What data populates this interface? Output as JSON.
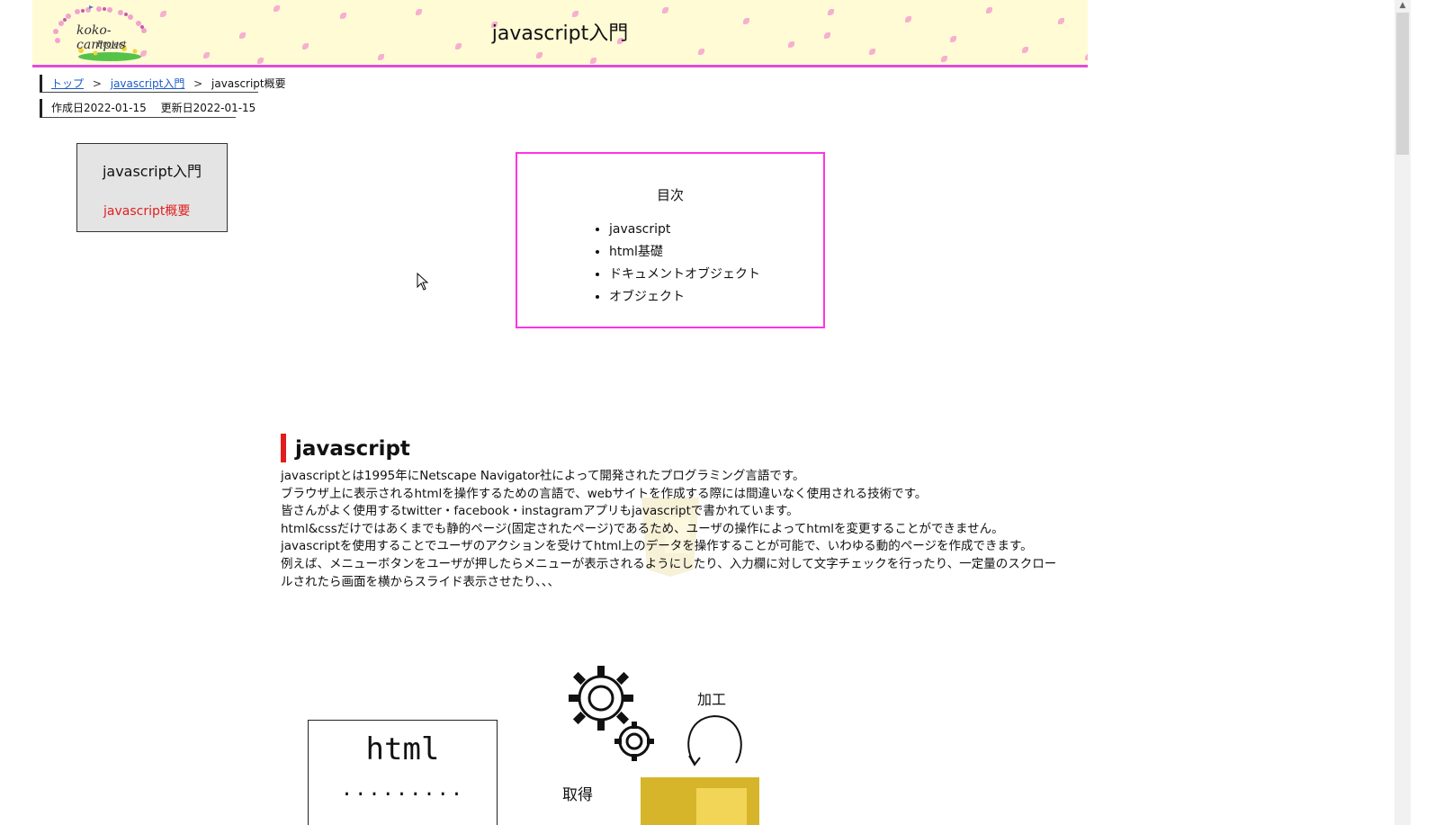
{
  "header": {
    "site_title": "javascript入門",
    "logo": {
      "text": "koko-campus",
      "sub": "Project"
    }
  },
  "breadcrumb": {
    "items": [
      {
        "label": "トップ",
        "link": true
      },
      {
        "label": "javascript入門",
        "link": true
      },
      {
        "label": "javascript概要",
        "link": false
      }
    ],
    "separator": ">"
  },
  "dates": {
    "created": "作成日2022-01-15",
    "updated": "更新日2022-01-15"
  },
  "sidenav": {
    "title": "javascript入門",
    "active_item": "javascript概要",
    "active_color": "#e02020"
  },
  "toc": {
    "title": "目次",
    "items": [
      "javascript",
      "html基礎",
      "ドキュメントオブジェクト",
      "オブジェクト"
    ],
    "border_color": "#ff33e6"
  },
  "section": {
    "heading": "javascript",
    "accent_color": "#e11d1d",
    "paragraphs": [
      "javascriptとは1995年にNetscape Navigator社によって開発されたプログラミング言語です。",
      "ブラウザ上に表示されるhtmlを操作するための言語で、webサイトを作成する際には間違いなく使用される技術です。",
      "皆さんがよく使用するtwitter・facebook・instagramアプリもjavascriptで書かれています。",
      "html&cssだけではあくまでも静的ページ(固定されたページ)であるため、ユーザの操作によってhtmlを変更することができません。",
      "javascriptを使用することでユーザのアクションを受けてhtml上のデータを操作することが可能で、いわゆる動的ページを作成できます。",
      "例えば、メニューボタンをユーザが押したらメニューが表示されるようにしたり、入力欄に対して文字チェックを行ったり、一定量のスクロールされたら画面を横からスライド表示させたり、、、"
    ]
  },
  "diagram": {
    "box_title": "html",
    "box_dots": ".........",
    "label_process": "加工",
    "label_fetch": "取得",
    "icons": [
      "gear-icon",
      "loop-arrow-icon",
      "javascript-logo-icon"
    ]
  },
  "colors": {
    "header_bg": "#fffbd5",
    "header_border": "#e14cd6",
    "sidenav_bg": "#e4e4e4",
    "link": "#1b5cc9"
  }
}
